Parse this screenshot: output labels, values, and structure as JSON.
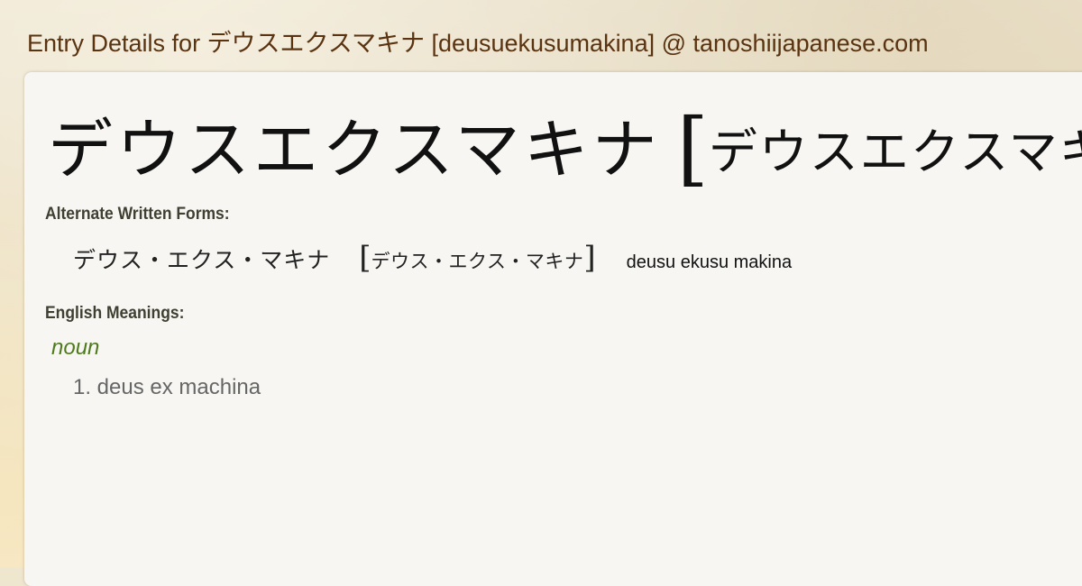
{
  "page": {
    "title": "Entry Details for デウスエクスマキナ [deusuekusumakina] @ tanoshiijapanese.com"
  },
  "entry": {
    "headword": "デウスエクスマキナ",
    "bracket_open": "[",
    "headword_reading": "デウスエクスマキナ",
    "alternate_label": "Alternate Written Forms:",
    "alternate": {
      "form": "デウス・エクス・マキナ",
      "bracket_open": "[",
      "reading": "デウス・エクス・マキナ",
      "bracket_close": "]",
      "romaji": "deusu ekusu makina"
    },
    "meanings_label": "English Meanings:",
    "part_of_speech": "noun",
    "meanings": [
      "1. deus ex machina"
    ]
  },
  "colors": {
    "title": "#5a3310",
    "part_of_speech": "#4f7a1c",
    "label": "#3f3f32",
    "meaning": "#666666",
    "card_bg": "#f7f6f2"
  }
}
